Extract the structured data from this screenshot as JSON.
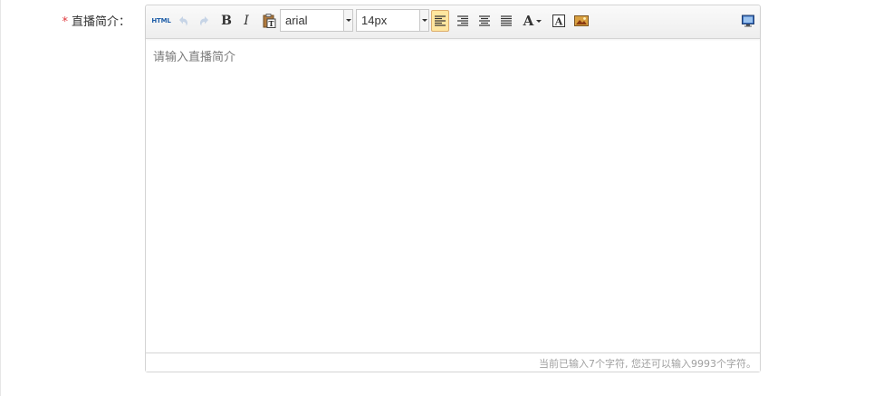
{
  "form": {
    "field": {
      "required_mark": "*",
      "label": "直播简介："
    }
  },
  "editor": {
    "toolbar": {
      "html_label": "HTML",
      "bold_label": "B",
      "italic_label": "I",
      "font_family_value": "arial",
      "font_size_value": "14px",
      "fore_color_label": "A",
      "icons": {
        "undo": "undo-icon",
        "redo": "redo-icon",
        "paste": "paste-plain-icon",
        "justify_left": "align-left-icon",
        "justify_right": "align-right-icon",
        "justify_center": "align-center-icon",
        "justify_full": "align-justify-icon",
        "back_color": "background-color-icon",
        "image": "insert-image-icon",
        "preview": "preview-monitor-icon"
      },
      "active_button": "justify_left"
    },
    "placeholder": "请输入直播简介",
    "word_count": "当前已输入7个字符, 您还可以输入9993个字符。"
  },
  "colors": {
    "required": "#e0393e",
    "active_button_bg": "#ffe69f",
    "active_button_border": "#dcac6c",
    "html_label": "#1f5ea8",
    "border": "#d4d4d4",
    "placeholder": "#7a7a7a",
    "counter": "#a0a0a0"
  }
}
